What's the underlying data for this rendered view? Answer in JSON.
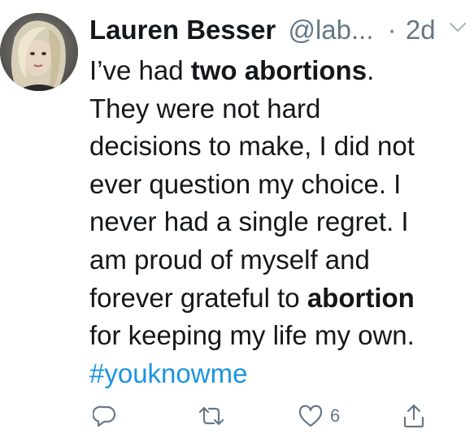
{
  "tweet": {
    "author_name": "Lauren Besser",
    "author_handle": "@lab...",
    "separator": "·",
    "time": "2d",
    "body_lines": [
      [
        {
          "t": "I’ve had "
        },
        {
          "t": "two abortions",
          "b": true
        },
        {
          "t": "."
        }
      ],
      [
        {
          "t": "They were not hard"
        }
      ],
      [
        {
          "t": "decisions to make, I did not"
        }
      ],
      [
        {
          "t": "ever question my choice. I"
        }
      ],
      [
        {
          "t": "never had a single regret. I"
        }
      ],
      [
        {
          "t": "am proud of myself and"
        }
      ],
      [
        {
          "t": "forever grateful to "
        },
        {
          "t": "abortion",
          "b": true
        }
      ],
      [
        {
          "t": "for keeping my life my own."
        }
      ]
    ],
    "hashtag": "#youknowme"
  },
  "actions": {
    "reply_icon": "reply-icon",
    "retweet_icon": "retweet-icon",
    "like_icon": "heart-icon",
    "like_count": "6",
    "share_icon": "share-icon"
  },
  "colors": {
    "text": "#14171a",
    "secondary": "#657786",
    "link": "#1b95e0"
  }
}
